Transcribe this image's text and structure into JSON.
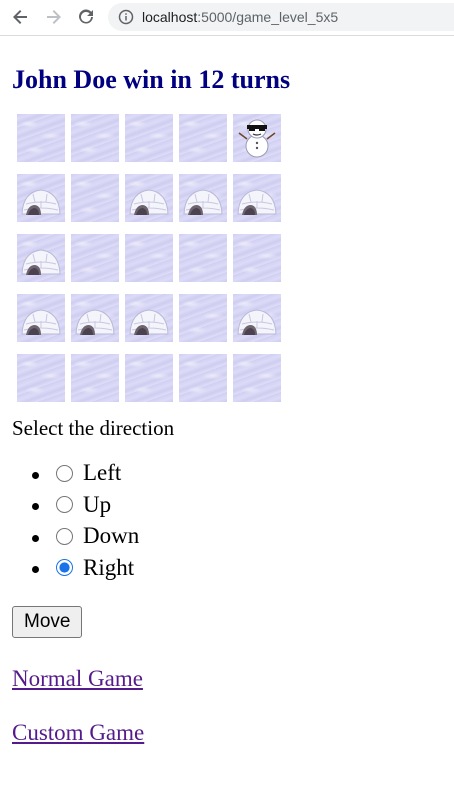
{
  "browser": {
    "url_host": "localhost",
    "url_path": ":5000/game_level_5x5"
  },
  "page": {
    "title": "John Doe win in 12 turns",
    "prompt": "Select the direction",
    "move_label": "Move",
    "links": [
      "Normal Game",
      "Custom Game"
    ]
  },
  "board": {
    "rows": [
      [
        "snow",
        "snow",
        "snow",
        "snow",
        "snowman"
      ],
      [
        "igloo",
        "snow",
        "igloo",
        "igloo",
        "igloo"
      ],
      [
        "igloo",
        "snow",
        "snow",
        "snow",
        "snow"
      ],
      [
        "igloo",
        "igloo",
        "igloo",
        "snow",
        "igloo"
      ],
      [
        "snow",
        "snow",
        "snow",
        "snow",
        "snow"
      ]
    ]
  },
  "directions": {
    "options": [
      "Left",
      "Up",
      "Down",
      "Right"
    ],
    "selected": "Right"
  }
}
